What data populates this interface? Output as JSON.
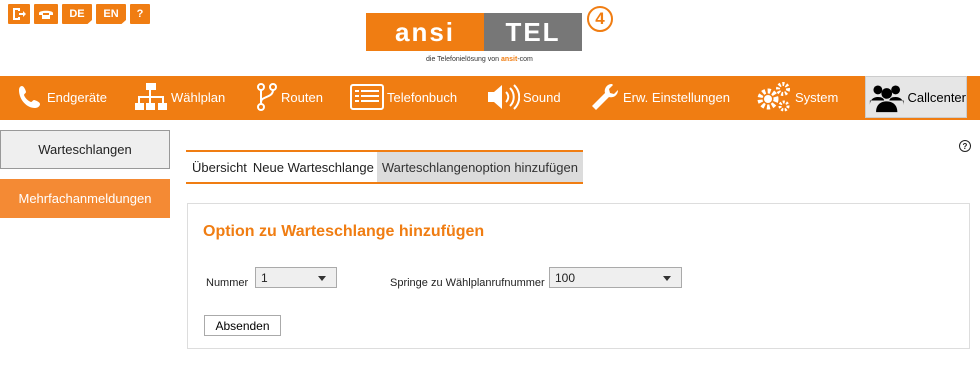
{
  "topbar": {
    "icons": [
      {
        "name": "logout-icon",
        "label": ""
      },
      {
        "name": "phone-icon",
        "label": ""
      },
      {
        "name": "lang-de",
        "label": "DE"
      },
      {
        "name": "lang-en",
        "label": "EN"
      },
      {
        "name": "help-icon",
        "label": "?"
      }
    ]
  },
  "logo": {
    "left": "ansi",
    "right": "TEL",
    "version": "4",
    "tagline_prefix": "die Telefonielösung von ",
    "tagline_brand": "ansit",
    "tagline_suffix": "-com"
  },
  "nav": {
    "items": [
      {
        "label": "Endgeräte",
        "icon": "phone-handset-icon"
      },
      {
        "label": "Wählplan",
        "icon": "sitemap-icon"
      },
      {
        "label": "Routen",
        "icon": "route-icon"
      },
      {
        "label": "Telefonbuch",
        "icon": "phonebook-icon"
      },
      {
        "label": "Sound",
        "icon": "speaker-icon"
      },
      {
        "label": "Erw. Einstellungen",
        "icon": "wrench-icon"
      },
      {
        "label": "System",
        "icon": "gears-icon"
      },
      {
        "label": "Callcenter",
        "icon": "users-icon",
        "active": true
      }
    ]
  },
  "sidebar": {
    "items": [
      {
        "label": "Warteschlangen"
      },
      {
        "label": "Mehrfachanmeldungen"
      }
    ]
  },
  "help_label": "?",
  "tabs": [
    {
      "label": "Übersicht"
    },
    {
      "label": "Neue Warteschlange"
    },
    {
      "label": "Warteschlangenoption hinzufügen",
      "active": true
    }
  ],
  "form": {
    "title": "Option zu Warteschlange hinzufügen",
    "nummer_label": "Nummer",
    "nummer_value": "1",
    "springe_label": "Springe zu Wählplanrufnummer",
    "springe_value": "100",
    "submit_label": "Absenden"
  },
  "colors": {
    "accent": "#f07d12",
    "nav_active_bg": "#e6e6e6",
    "sidebar_active_bg": "#f48a34"
  }
}
